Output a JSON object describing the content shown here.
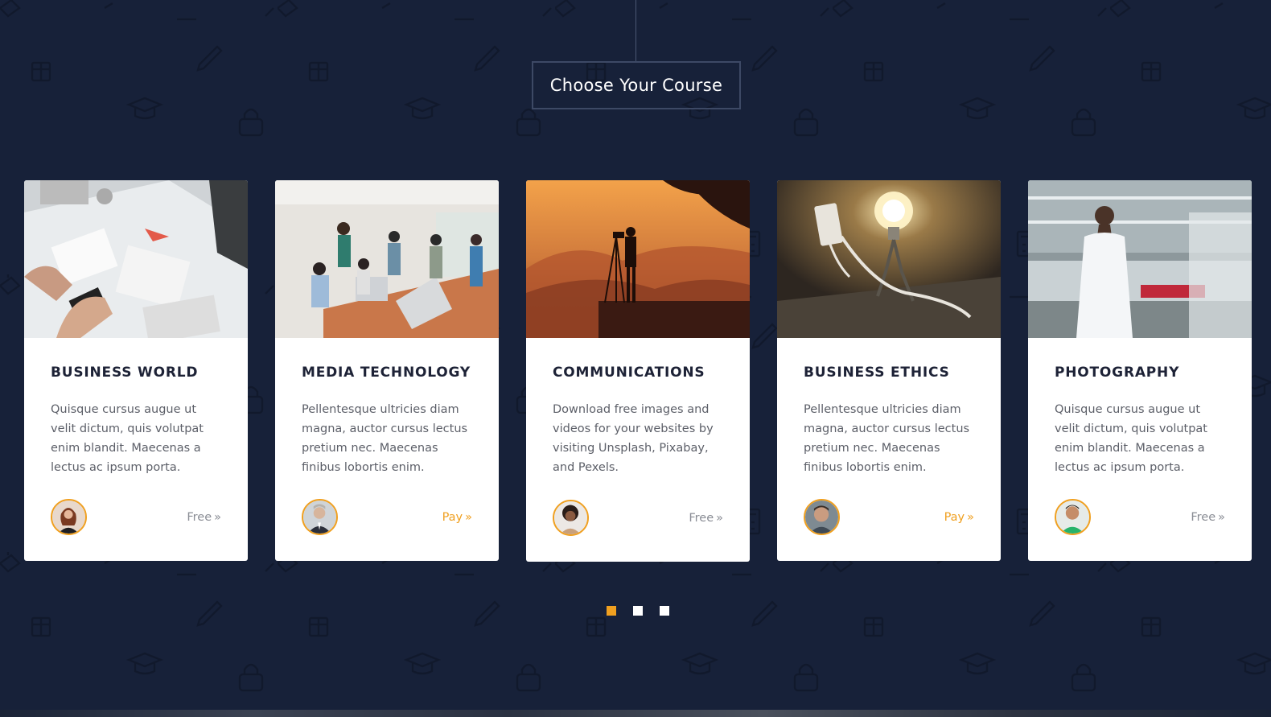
{
  "section_title": "Choose Your Course",
  "colors": {
    "background": "#172139",
    "accent": "#f0a020",
    "card_bg": "#ffffff"
  },
  "courses": [
    {
      "title": "BUSINESS WORLD",
      "description": "Quisque cursus augue ut velit dictum, quis volutpat enim blandit. Maecenas a lectus ac ipsum porta.",
      "price": "Free",
      "price_icon": "double-chevron-right-icon"
    },
    {
      "title": "MEDIA TECHNOLOGY",
      "description": "Pellentesque ultricies diam magna, auctor cursus lectus pretium nec. Maecenas finibus lobortis enim.",
      "price": "Pay",
      "price_icon": "double-chevron-right-icon"
    },
    {
      "title": "COMMUNICATIONS",
      "description": "Download free images and videos for your websites by visiting Unsplash, Pixabay, and Pexels.",
      "price": "Free",
      "price_icon": "double-chevron-right-icon"
    },
    {
      "title": "BUSINESS ETHICS",
      "description": "Pellentesque ultricies diam magna, auctor cursus lectus pretium nec. Maecenas finibus lobortis enim.",
      "price": "Pay",
      "price_icon": "double-chevron-right-icon"
    },
    {
      "title": "PHOTOGRAPHY",
      "description": "Quisque cursus augue ut velit dictum, quis volutpat enim blandit. Maecenas a lectus ac ipsum porta.",
      "price": "Free",
      "price_icon": "double-chevron-right-icon"
    }
  ],
  "pagination": {
    "pages": 3,
    "active": 1
  }
}
